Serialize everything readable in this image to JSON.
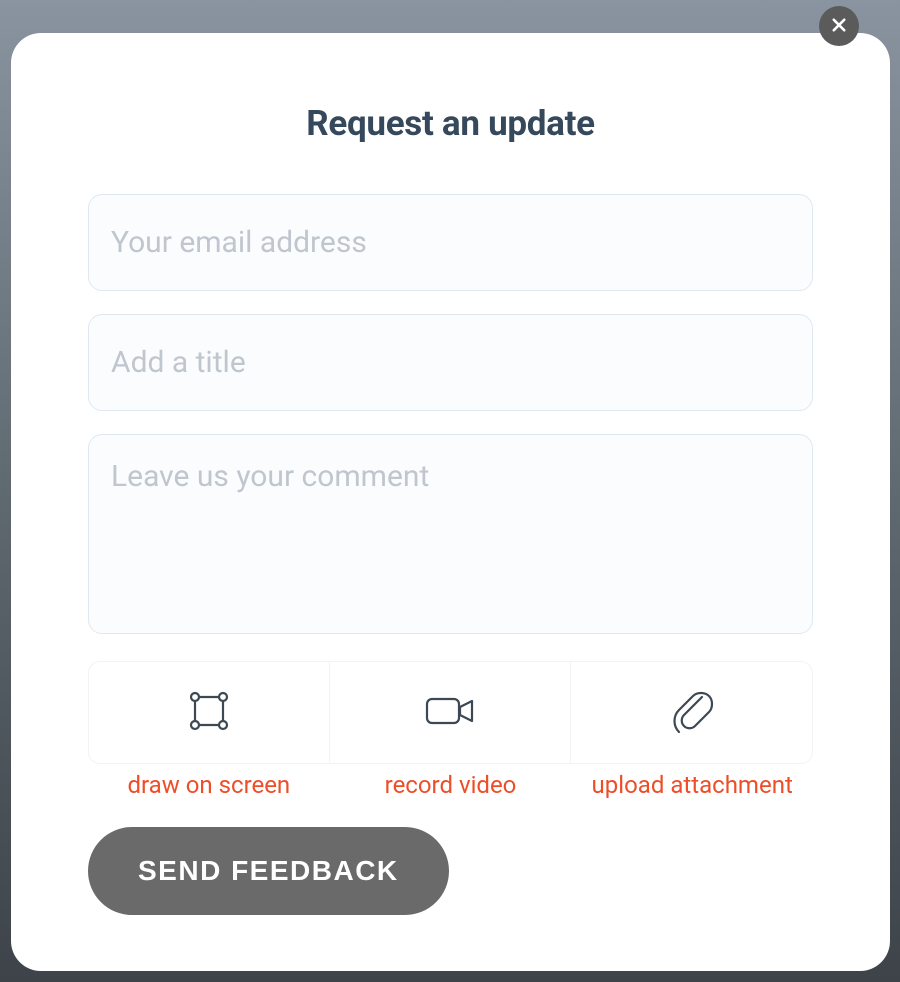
{
  "modal": {
    "title": "Request an update",
    "email_placeholder": "Your email address",
    "title_placeholder": "Add a title",
    "comment_placeholder": "Leave us your comment",
    "actions": {
      "draw_label": "draw on screen",
      "record_label": "record video",
      "upload_label": "upload attachment"
    },
    "submit_label": "SEND FEEDBACK"
  },
  "colors": {
    "text_primary": "#36485b",
    "accent": "#ed4e28",
    "button_bg": "#6a6a6a",
    "border": "#dfe8f0"
  }
}
